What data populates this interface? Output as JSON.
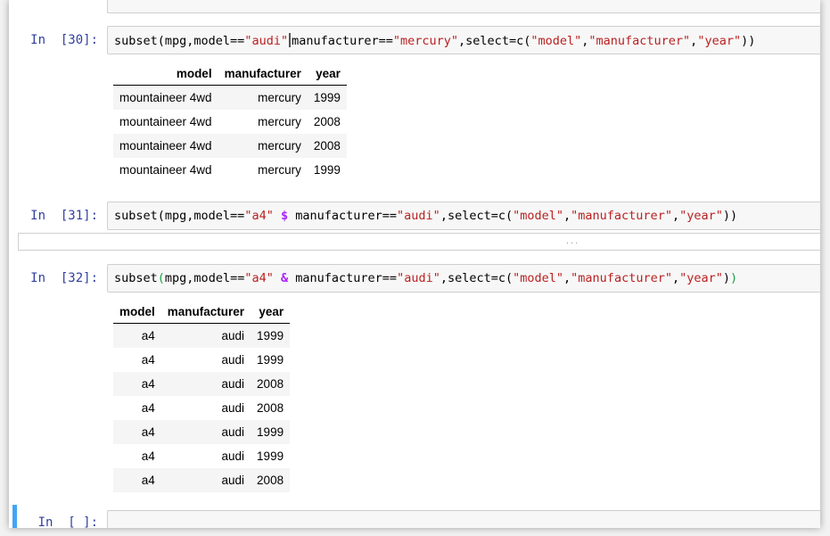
{
  "cells": [
    {
      "prompt": "In  [30]:",
      "code_parts": {
        "p1": "subset(mpg,model==",
        "s1": "\"audi\"",
        "p2": "manufacturer==",
        "s2": "\"mercury\"",
        "p3": ",select=c(",
        "s3": "\"model\"",
        "p4": ",",
        "s4": "\"manufacturer\"",
        "p5": ",",
        "s5": "\"year\"",
        "p6": "))"
      },
      "output": {
        "columns": [
          "model",
          "manufacturer",
          "year"
        ],
        "rows": [
          [
            "mountaineer 4wd",
            "mercury",
            "1999"
          ],
          [
            "mountaineer 4wd",
            "mercury",
            "2008"
          ],
          [
            "mountaineer 4wd",
            "mercury",
            "2008"
          ],
          [
            "mountaineer 4wd",
            "mercury",
            "1999"
          ]
        ]
      }
    },
    {
      "prompt": "In  [31]:",
      "code_parts": {
        "p1": "subset(mpg,model==",
        "s1": "\"a4\"",
        "op": "$",
        "p2": "manufacturer==",
        "s2": "\"audi\"",
        "p3": ",select=c(",
        "s3": "\"model\"",
        "p4": ",",
        "s4": "\"manufacturer\"",
        "p5": ",",
        "s5": "\"year\"",
        "p6": "))"
      },
      "collapsed_marker": "..."
    },
    {
      "prompt": "In  [32]:",
      "code_parts": {
        "p1": "subset",
        "paren_open": "(",
        "p1b": "mpg,model==",
        "s1": "\"a4\"",
        "op": "&",
        "p2": "manufacturer==",
        "s2": "\"audi\"",
        "p3": ",select=c(",
        "s3": "\"model\"",
        "p4": ",",
        "s4": "\"manufacturer\"",
        "p5": ",",
        "s5": "\"year\"",
        "p6": ")",
        "paren_close": ")"
      },
      "output": {
        "columns": [
          "model",
          "manufacturer",
          "year"
        ],
        "rows": [
          [
            "a4",
            "audi",
            "1999"
          ],
          [
            "a4",
            "audi",
            "1999"
          ],
          [
            "a4",
            "audi",
            "2008"
          ],
          [
            "a4",
            "audi",
            "2008"
          ],
          [
            "a4",
            "audi",
            "1999"
          ],
          [
            "a4",
            "audi",
            "1999"
          ],
          [
            "a4",
            "audi",
            "2008"
          ]
        ]
      }
    },
    {
      "prompt": "In  [ ]:"
    }
  ],
  "colors": {
    "prompt": "#303f9f",
    "string": "#ba2121",
    "operator": "#aa22ff",
    "bracket_match": "#19a34b",
    "selected_cell": "#42a5f5"
  }
}
